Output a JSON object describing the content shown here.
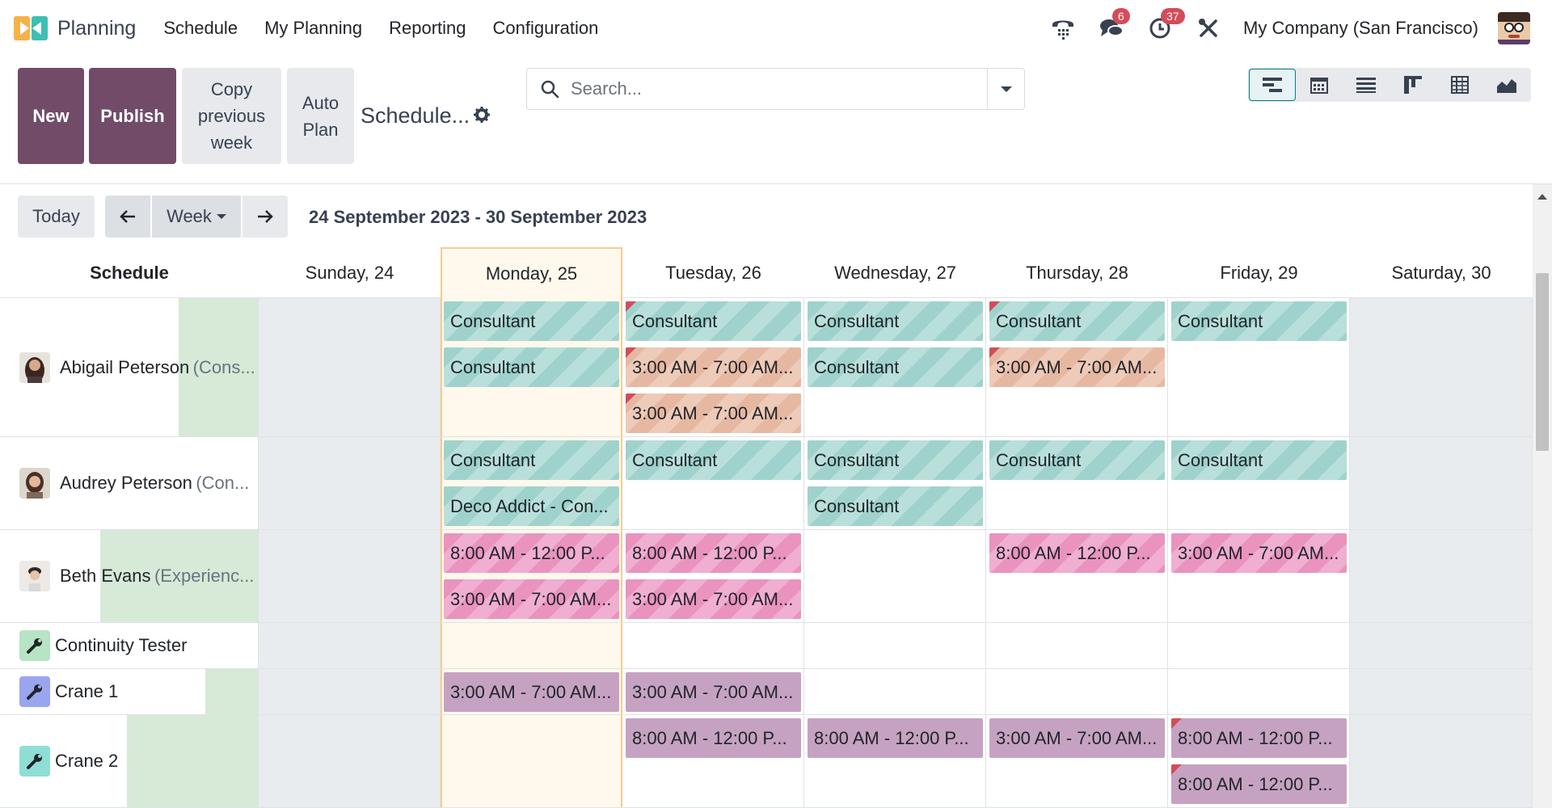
{
  "app": {
    "brand": "Planning",
    "menu": [
      "Schedule",
      "My Planning",
      "Reporting",
      "Configuration"
    ],
    "company": "My Company (San Francisco)",
    "messages_badge": "6",
    "activities_badge": "37"
  },
  "control": {
    "new": "New",
    "publish": "Publish",
    "copy_line1": "Copy",
    "copy_line2": "previous",
    "copy_line3": "week",
    "auto_line1": "Auto",
    "auto_line2": "Plan",
    "breadcrumb": "Schedule...",
    "search_placeholder": "Search..."
  },
  "views": [
    "gantt-icon",
    "calendar-icon",
    "list-icon",
    "kanban-icon",
    "pivot-icon",
    "graph-icon"
  ],
  "toolbar": {
    "today": "Today",
    "scale": "Week",
    "range": "24 September 2023 - 30 September 2023"
  },
  "header": {
    "schedule": "Schedule",
    "days": [
      "Sunday, 24",
      "Monday, 25",
      "Tuesday, 26",
      "Wednesday, 27",
      "Thursday, 28",
      "Friday, 29",
      "Saturday, 30"
    ]
  },
  "rows": [
    {
      "name": "Abigail Peterson",
      "role": "(Cons..."
    },
    {
      "name": "Audrey Peterson",
      "role": "(Con..."
    },
    {
      "name": "Beth Evans",
      "role": "(Experienc..."
    },
    {
      "name": "Continuity Tester",
      "role": ""
    },
    {
      "name": "Crane 1",
      "role": ""
    },
    {
      "name": "Crane 2",
      "role": ""
    }
  ],
  "shifts": {
    "consultant": "Consultant",
    "early": "3:00 AM - 7:00 AM...",
    "morning": "8:00 AM - 12:00 P...",
    "deco": "Deco Addict - Con..."
  },
  "colors": {
    "primary": "#714b67",
    "teal": "#9fd2cc",
    "peach": "#e6b8a2",
    "pink": "#e993be",
    "mauve": "#c6a2c2",
    "today_bg": "#fef9ec",
    "weekend_bg": "#e9ecef",
    "load_green": "#d6ead7"
  }
}
